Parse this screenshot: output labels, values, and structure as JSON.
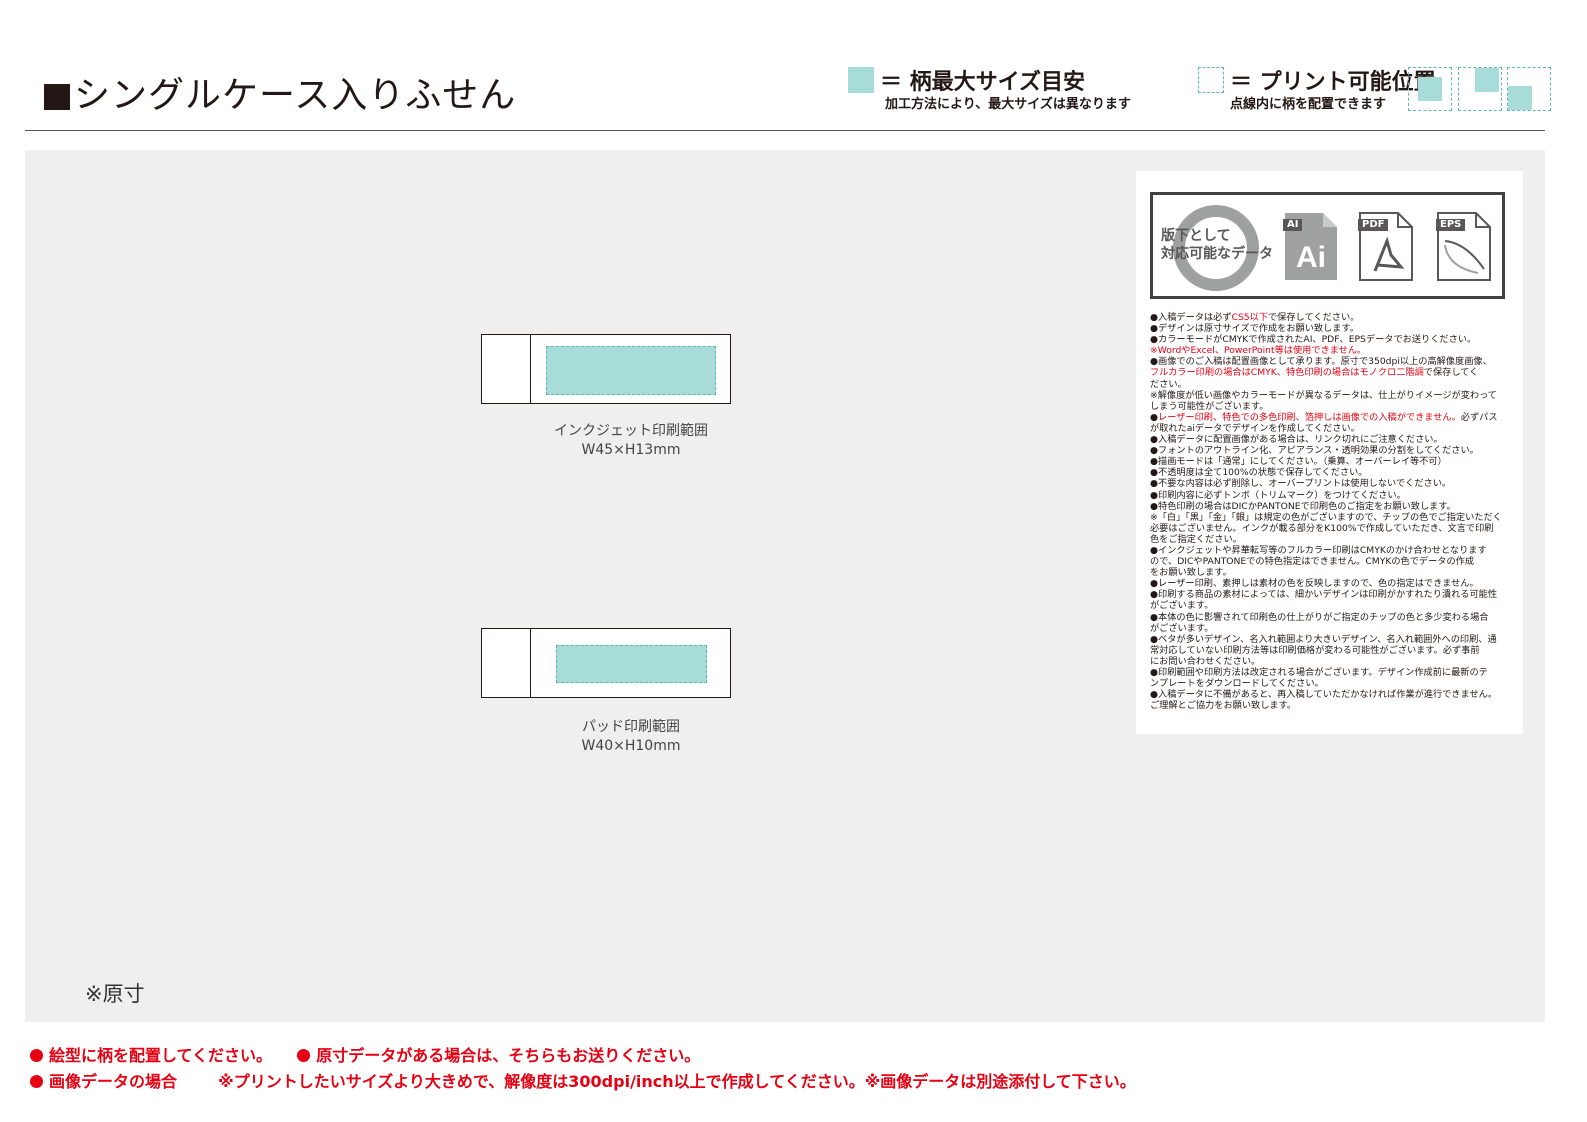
{
  "header": {
    "title": "シングルケース入りふせん",
    "legend_max": {
      "label": "＝ 柄最大サイズ目安",
      "sub": "加工方法により、最大サイズは異なります"
    },
    "legend_print": {
      "label": "＝ プリント可能位置",
      "sub": "点線内に柄を配置できます"
    }
  },
  "areas": [
    {
      "name": "インクジェット印刷範囲",
      "size": "W45×H13mm"
    },
    {
      "name": "パッド印刷範囲",
      "size": "W40×H10mm"
    }
  ],
  "canvas_note": "※原寸",
  "data_panel": {
    "formats_label_line1": "版下として",
    "formats_label_line2": "対応可能なデータ",
    "formats": [
      "AI",
      "PDF",
      "EPS"
    ],
    "ai_mark": "Ai",
    "rules": [
      {
        "pre": "●入稿データは必ず",
        "red": "CS5以下",
        "post": "で保存してください。"
      },
      {
        "pre": "●デザインは原寸サイズで作成をお願い致します。",
        "red": "",
        "post": ""
      },
      {
        "pre": "●カラーモードがCMYKで作成されたAI、PDF、EPSデータでお送りください。",
        "red": "",
        "post": ""
      },
      {
        "pre": "",
        "red": "※WordやExcel、PowerPoint等は使用できません。",
        "post": ""
      },
      {
        "pre": "●画像でのご入稿は配置画像として承ります。原寸で350dpi以上の高解像度画像、",
        "red": "",
        "post": ""
      },
      {
        "pre": "  ",
        "red": "フルカラー印刷の場合はCMYK、特色印刷の場合はモノクロ二階調",
        "post": "で保存してく"
      },
      {
        "pre": "  ださい。",
        "red": "",
        "post": ""
      },
      {
        "pre": "※解像度が低い画像やカラーモードが異なるデータは、仕上がりイメージが変わって",
        "red": "",
        "post": ""
      },
      {
        "pre": "  しまう可能性がございます。",
        "red": "",
        "post": ""
      },
      {
        "pre": "●",
        "red": "レーザー印刷、特色での多色印刷、箔押しは画像での入稿ができません。",
        "post": "必ずパス"
      },
      {
        "pre": "  が取れたaiデータでデザインを作成してください。",
        "red": "",
        "post": ""
      },
      {
        "pre": "●入稿データに配置画像がある場合は、リンク切れにご注意ください。",
        "red": "",
        "post": ""
      },
      {
        "pre": "●フォントのアウトライン化、アピアランス・透明効果の分割をしてください。",
        "red": "",
        "post": ""
      },
      {
        "pre": "●描画モードは「通常」にしてください。（乗算、オーバーレイ等不可）",
        "red": "",
        "post": ""
      },
      {
        "pre": "●不透明度は全て100%の状態で保存してください。",
        "red": "",
        "post": ""
      },
      {
        "pre": "●不要な内容は必ず削除し、オーバープリントは使用しないでください。",
        "red": "",
        "post": ""
      },
      {
        "pre": "●印刷内容に必ずトンボ（トリムマーク）をつけてください。",
        "red": "",
        "post": ""
      },
      {
        "pre": "●特色印刷の場合はDICかPANTONEで印刷色のご指定をお願い致します。",
        "red": "",
        "post": ""
      },
      {
        "pre": "※「白」「黒」「金」「銀」は規定の色がございますので、チップの色でご指定いただく",
        "red": "",
        "post": ""
      },
      {
        "pre": "  必要はございません。インクが載る部分をK100%で作成していただき、文言で印刷",
        "red": "",
        "post": ""
      },
      {
        "pre": "  色をご指定ください。",
        "red": "",
        "post": ""
      },
      {
        "pre": "●インクジェットや昇華転写等のフルカラー印刷はCMYKのかけ合わせとなります",
        "red": "",
        "post": ""
      },
      {
        "pre": "  ので、DICやPANTONEでの特色指定はできません。CMYKの色でデータの作成",
        "red": "",
        "post": ""
      },
      {
        "pre": "  をお願い致します。",
        "red": "",
        "post": ""
      },
      {
        "pre": "●レーザー印刷、素押しは素材の色を反映しますので、色の指定はできません。",
        "red": "",
        "post": ""
      },
      {
        "pre": "●印刷する商品の素材によっては、細かいデザインは印刷がかすれたり潰れる可能性",
        "red": "",
        "post": ""
      },
      {
        "pre": "  がございます。",
        "red": "",
        "post": ""
      },
      {
        "pre": "●本体の色に影響されて印刷色の仕上がりがご指定のチップの色と多少変わる場合",
        "red": "",
        "post": ""
      },
      {
        "pre": "  がございます。",
        "red": "",
        "post": ""
      },
      {
        "pre": "●ベタが多いデザイン、名入れ範囲より大きいデザイン、名入れ範囲外への印刷、通",
        "red": "",
        "post": ""
      },
      {
        "pre": "  常対応していない印刷方法等は印刷価格が変わる可能性がございます。必ず事前",
        "red": "",
        "post": ""
      },
      {
        "pre": "  にお問い合わせください。",
        "red": "",
        "post": ""
      },
      {
        "pre": "●印刷範囲や印刷方法は改定される場合がございます。デザイン作成前に最新のテ",
        "red": "",
        "post": ""
      },
      {
        "pre": "  ンプレートをダウンロードしてください。",
        "red": "",
        "post": ""
      },
      {
        "pre": "●入稿データに不備があると、再入稿していただかなければ作業が進行できません。",
        "red": "",
        "post": ""
      },
      {
        "pre": "  ご理解とご協力をお願い致します。",
        "red": "",
        "post": ""
      }
    ]
  },
  "footer": {
    "note1": "絵型に柄を配置してください。",
    "note2": "原寸データがある場合は、そちらもお送りください。",
    "note3": "画像データの場合",
    "note3_detail": "※プリントしたいサイズより大きめで、解像度は300dpi/inch以上で作成してください。※画像データは別途添付して下さい。"
  },
  "colors": {
    "max_area": "#a8dcd9",
    "print_dash": "#5fb8b3",
    "accent_red": "#e60012",
    "canvas_bg": "#eeefee"
  }
}
